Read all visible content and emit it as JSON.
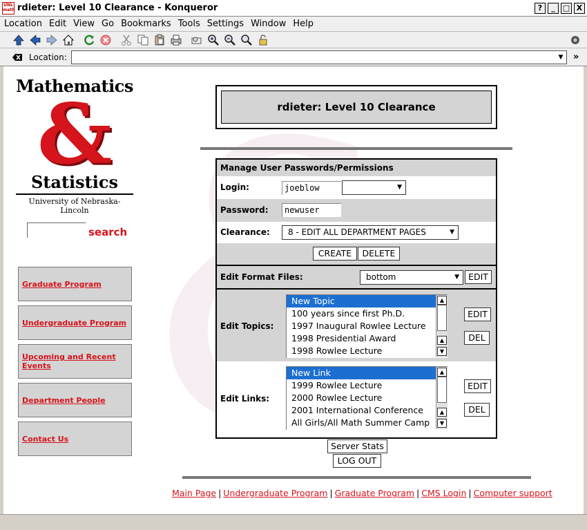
{
  "window": {
    "title": "rdieter: Level 10  Clearance - Konqueror",
    "app_icon_text": "UNL math",
    "buttons": [
      "?",
      "_",
      "□",
      "X"
    ]
  },
  "menubar": [
    "Location",
    "Edit",
    "View",
    "Go",
    "Bookmarks",
    "Tools",
    "Settings",
    "Window",
    "Help"
  ],
  "toolbar": {
    "icons": [
      "up-arrow-icon",
      "back-arrow-icon",
      "forward-arrow-icon",
      "home-icon",
      "reload-icon",
      "stop-icon",
      "cut-icon",
      "copy-icon",
      "paste-icon",
      "print-icon",
      "find-icon",
      "zoom-in-icon",
      "zoom-out-icon",
      "zoom-fit-icon",
      "security-lock-icon"
    ]
  },
  "location": {
    "label": "Location:",
    "value": "",
    "more": "»"
  },
  "sidebar": {
    "logo_top": "Mathematics",
    "logo_amp": "&",
    "logo_bottom": "Statistics",
    "logo_sub": "University of Nebraska-Lincoln",
    "search_label": "search",
    "search_value": "",
    "nav": [
      {
        "label": "Graduate Program"
      },
      {
        "label": "Undergraduate Program"
      },
      {
        "label": "Upcoming and Recent Events"
      },
      {
        "label": "Department People"
      },
      {
        "label": "Contact Us"
      }
    ]
  },
  "header": {
    "title": "rdieter: Level 10 Clearance"
  },
  "manage": {
    "heading": "Manage User Passwords/Permissions",
    "login_label": "Login:",
    "login_value": "joeblow",
    "login_select": "",
    "password_label": "Password:",
    "password_value": "newuser",
    "clearance_label": "Clearance:",
    "clearance_value": "8 - EDIT ALL DEPARTMENT PAGES",
    "create_label": "CREATE",
    "delete_label": "DELETE"
  },
  "format": {
    "label": "Edit Format Files:",
    "value": "bottom",
    "edit_label": "EDIT"
  },
  "topics": {
    "label": "Edit Topics:",
    "options": [
      "New Topic",
      "100 years since first Ph.D.",
      "1997 Inaugural Rowlee Lecture",
      "1998 Presidential Award",
      "1998 Rowlee Lecture"
    ],
    "edit_label": "EDIT",
    "del_label": "DEL"
  },
  "links": {
    "label": "Edit Links:",
    "options": [
      "New Link",
      "1999 Rowlee Lecture",
      "2000 Rowlee Lecture",
      "2001 International Conference",
      "All Girls/All Math Summer Camp"
    ],
    "edit_label": "EDIT",
    "del_label": "DEL"
  },
  "actions": {
    "server_stats": "Server Stats",
    "logout": "LOG OUT"
  },
  "footer": {
    "links": [
      "Main Page",
      "Undergraduate Program",
      "Graduate Program",
      "CMS Login",
      "Computer support"
    ],
    "separator": "|"
  },
  "colors": {
    "brand_red": "#d6141c",
    "selection_blue": "#1c6fd0",
    "panel_grey": "#d4d4d4"
  }
}
